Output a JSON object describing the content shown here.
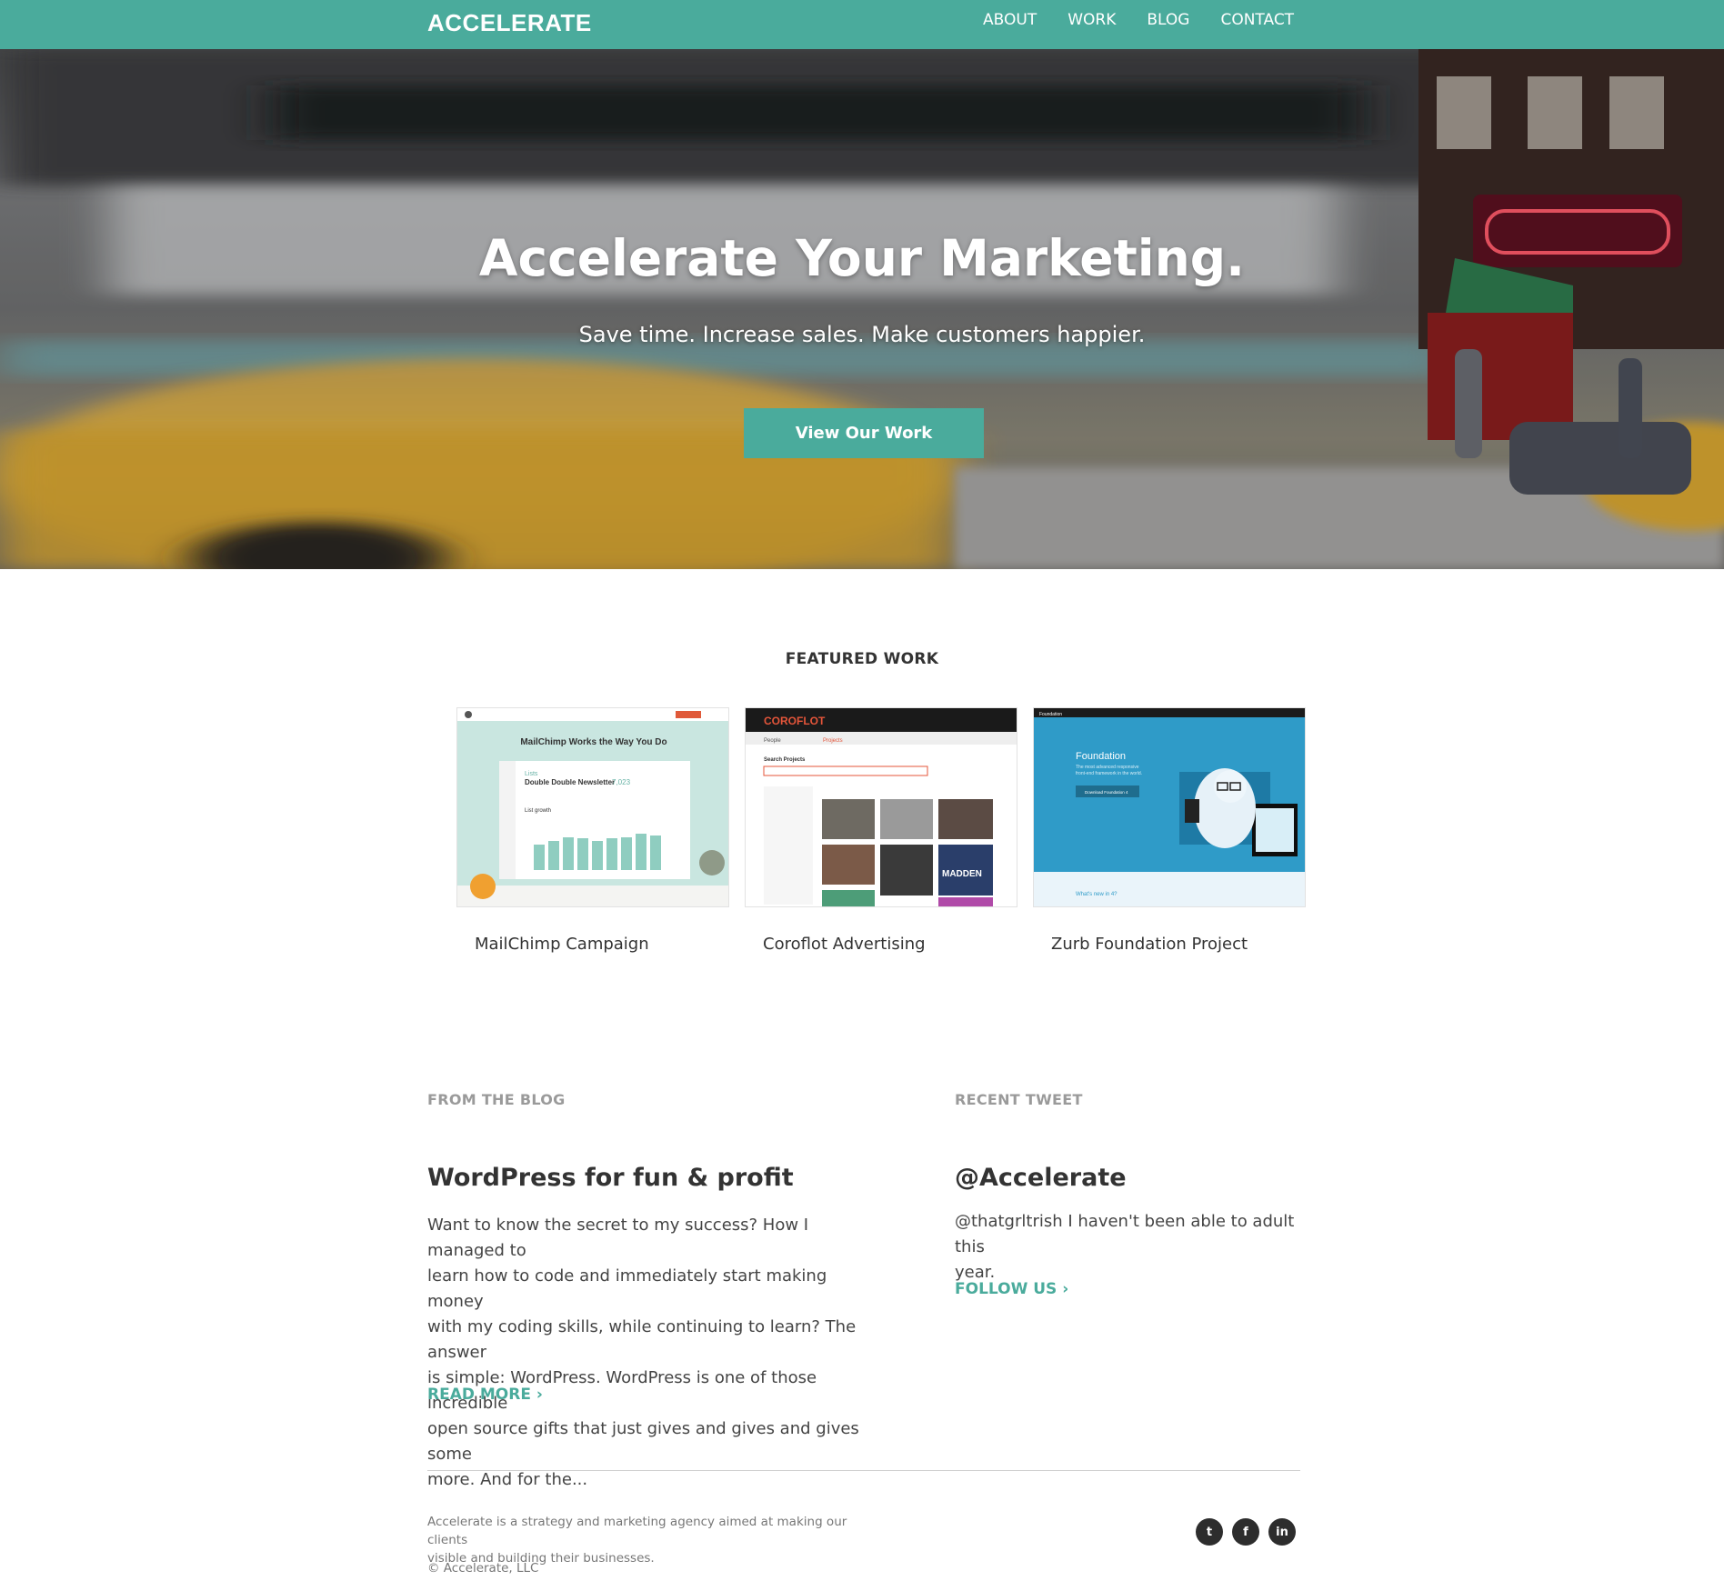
{
  "header": {
    "logo": "ACCELERATE",
    "nav": [
      "ABOUT",
      "WORK",
      "BLOG",
      "CONTACT"
    ]
  },
  "hero": {
    "title": "Accelerate Your Marketing.",
    "subtitle": "Save time. Increase sales. Make customers happier.",
    "button": "View Our Work"
  },
  "featured": {
    "title": "FEATURED WORK",
    "items": [
      {
        "name": "MailChimp Campaign",
        "thumb": {
          "heading": "MailChimp Works the Way You Do",
          "list_label": "Lists",
          "list_title": "Double Double Newsletter",
          "list_count": "7,023",
          "growth_label": "List growth"
        }
      },
      {
        "name": "Coroflot Advertising",
        "thumb": {
          "brand": "COROFLOT",
          "tab_people": "People",
          "tab_projects": "Projects",
          "search_label": "Search Projects",
          "game_title": "MADDEN"
        }
      },
      {
        "name": "Zurb Foundation Project",
        "thumb": {
          "brand": "Foundation",
          "headline": "Foundation",
          "tagline_1": "The most advanced responsive",
          "tagline_2": "front-end framework in the world.",
          "download": "Download Foundation 4",
          "whats_new": "What's new in 4?"
        }
      }
    ]
  },
  "blog": {
    "label": "FROM THE BLOG",
    "title": "WordPress for fun & profit",
    "excerpt_lines": [
      "Want to know the secret to my success? How I managed to",
      "learn how to code and immediately start making money",
      "with my coding skills, while continuing to learn? The answer",
      "is simple: WordPress. WordPress is one of those incredible",
      "open source gifts that just gives and gives and gives some",
      "more. And for the..."
    ],
    "read_more": "READ MORE ›"
  },
  "tweet": {
    "label": "RECENT TWEET",
    "handle": "@Accelerate",
    "text_lines": [
      "@thatgrltrish I haven't been able to adult this",
      "year."
    ],
    "follow": "FOLLOW US ›"
  },
  "footer": {
    "about_lines": [
      "Accelerate is a strategy and marketing agency aimed at making our clients",
      "visible and building their businesses."
    ],
    "copyright": "© Accelerate, LLC",
    "social": [
      {
        "icon": "twitter-icon",
        "glyph": "t"
      },
      {
        "icon": "facebook-icon",
        "glyph": "f"
      },
      {
        "icon": "linkedin-icon",
        "glyph": "in"
      }
    ]
  },
  "colors": {
    "accent": "#4aab9c",
    "text_dark": "#333333",
    "text_muted": "#9a9a9a",
    "social_bg": "#2d2d2d"
  }
}
